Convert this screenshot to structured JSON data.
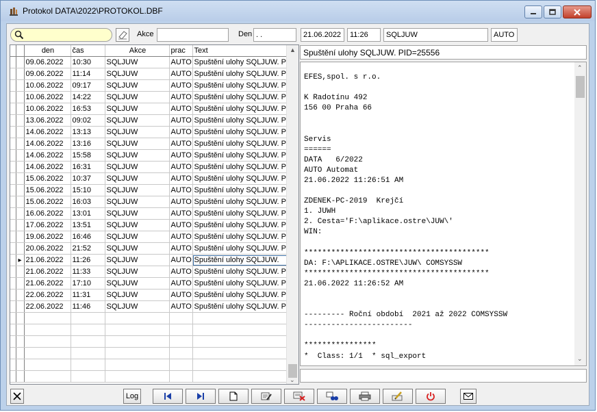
{
  "window": {
    "title": "Protokol DATA\\2022\\PROTOKOL.DBF"
  },
  "filters": {
    "search_value": "",
    "akce_label": "Akce",
    "akce_value": "",
    "den_label": "Den",
    "den_value": "  .  ."
  },
  "detail": {
    "date": "21.06.2022",
    "time": "11:26",
    "action": "SQLJUW",
    "prac": "AUTO",
    "header_text": "Spuštění ulohy SQLJUW. PID=25556",
    "memo": "EFES,spol. s r.o.\n\nK Radotínu 492\n156 00 Praha 66\n\n\nServis\n======\nDATA   6/2022\nAUTO Automat\n21.06.2022 11:26:51 AM\n\nZDENEK-PC-2019  Krejčí\n1. JUWH\n2. Cesta='F:\\aplikace.ostre\\JUW\\'\nWIN:\n\n*****************************************\nDA: F:\\APLIKACE.OSTRE\\JUW\\ COMSYSSW\n*****************************************\n21.06.2022 11:26:52 AM\n\n\n--------- Roční období  2021 až 2022 COMSYSSW\n------------------------\n\n****************\n*  Class: 1/1  * sql_export"
  },
  "grid": {
    "columns": [
      "den",
      "čas",
      "Akce",
      "prac",
      "Text"
    ],
    "rows": [
      {
        "den": "09.06.2022",
        "cas": "10:30",
        "akce": "SQLJUW",
        "prac": "AUTO",
        "text": "Spuštění ulohy SQLJUW. P"
      },
      {
        "den": "09.06.2022",
        "cas": "11:14",
        "akce": "SQLJUW",
        "prac": "AUTO",
        "text": "Spuštění ulohy SQLJUW. P"
      },
      {
        "den": "10.06.2022",
        "cas": "09:17",
        "akce": "SQLJUW",
        "prac": "AUTO",
        "text": "Spuštění ulohy SQLJUW. P"
      },
      {
        "den": "10.06.2022",
        "cas": "14:22",
        "akce": "SQLJUW",
        "prac": "AUTO",
        "text": "Spuštění ulohy SQLJUW. P"
      },
      {
        "den": "10.06.2022",
        "cas": "16:53",
        "akce": "SQLJUW",
        "prac": "AUTO",
        "text": "Spuštění ulohy SQLJUW. P"
      },
      {
        "den": "13.06.2022",
        "cas": "09:02",
        "akce": "SQLJUW",
        "prac": "AUTO",
        "text": "Spuštění ulohy SQLJUW. P"
      },
      {
        "den": "14.06.2022",
        "cas": "13:13",
        "akce": "SQLJUW",
        "prac": "AUTO",
        "text": "Spuštění ulohy SQLJUW. P"
      },
      {
        "den": "14.06.2022",
        "cas": "13:16",
        "akce": "SQLJUW",
        "prac": "AUTO",
        "text": "Spuštění ulohy SQLJUW. P"
      },
      {
        "den": "14.06.2022",
        "cas": "15:58",
        "akce": "SQLJUW",
        "prac": "AUTO",
        "text": "Spuštění ulohy SQLJUW. P"
      },
      {
        "den": "14.06.2022",
        "cas": "16:31",
        "akce": "SQLJUW",
        "prac": "AUTO",
        "text": "Spuštění ulohy SQLJUW. P"
      },
      {
        "den": "15.06.2022",
        "cas": "10:37",
        "akce": "SQLJUW",
        "prac": "AUTO",
        "text": "Spuštění ulohy SQLJUW. P"
      },
      {
        "den": "15.06.2022",
        "cas": "15:10",
        "akce": "SQLJUW",
        "prac": "AUTO",
        "text": "Spuštění ulohy SQLJUW. P"
      },
      {
        "den": "15.06.2022",
        "cas": "16:03",
        "akce": "SQLJUW",
        "prac": "AUTO",
        "text": "Spuštění ulohy SQLJUW. P"
      },
      {
        "den": "16.06.2022",
        "cas": "13:01",
        "akce": "SQLJUW",
        "prac": "AUTO",
        "text": "Spuštění ulohy SQLJUW. P"
      },
      {
        "den": "17.06.2022",
        "cas": "13:51",
        "akce": "SQLJUW",
        "prac": "AUTO",
        "text": "Spuštění ulohy SQLJUW. P"
      },
      {
        "den": "19.06.2022",
        "cas": "16:46",
        "akce": "SQLJUW",
        "prac": "AUTO",
        "text": "Spuštění ulohy SQLJUW. P"
      },
      {
        "den": "20.06.2022",
        "cas": "21:52",
        "akce": "SQLJUW",
        "prac": "AUTO",
        "text": "Spuštění ulohy SQLJUW. P"
      },
      {
        "den": "21.06.2022",
        "cas": "11:26",
        "akce": "SQLJUW",
        "prac": "AUTO",
        "text": "Spuštění ulohy SQLJUW.",
        "selected": true
      },
      {
        "den": "21.06.2022",
        "cas": "11:33",
        "akce": "SQLJUW",
        "prac": "AUTO",
        "text": "Spuštění ulohy SQLJUW. P"
      },
      {
        "den": "21.06.2022",
        "cas": "17:10",
        "akce": "SQLJUW",
        "prac": "AUTO",
        "text": "Spuštění ulohy SQLJUW. P"
      },
      {
        "den": "22.06.2022",
        "cas": "11:31",
        "akce": "SQLJUW",
        "prac": "AUTO",
        "text": "Spuštění ulohy SQLJUW. P"
      },
      {
        "den": "22.06.2022",
        "cas": "11:46",
        "akce": "SQLJUW",
        "prac": "AUTO",
        "text": "Spuštění ulohy SQLJUW. P"
      }
    ],
    "empty_rows": 6
  },
  "toolbar": {
    "log_label": "Log",
    "icons": [
      "close-x-icon",
      "first-record-icon",
      "last-record-icon",
      "new-document-icon",
      "edit-icon",
      "delete-icon",
      "search-binoculars-icon",
      "print-icon",
      "pencil-icon",
      "power-icon",
      "mail-icon"
    ]
  },
  "colors": {
    "search_bg": "#ffffcc",
    "first_last_arrows": "#1a3fa8",
    "power": "#d92020",
    "delete_x": "#d92020"
  }
}
